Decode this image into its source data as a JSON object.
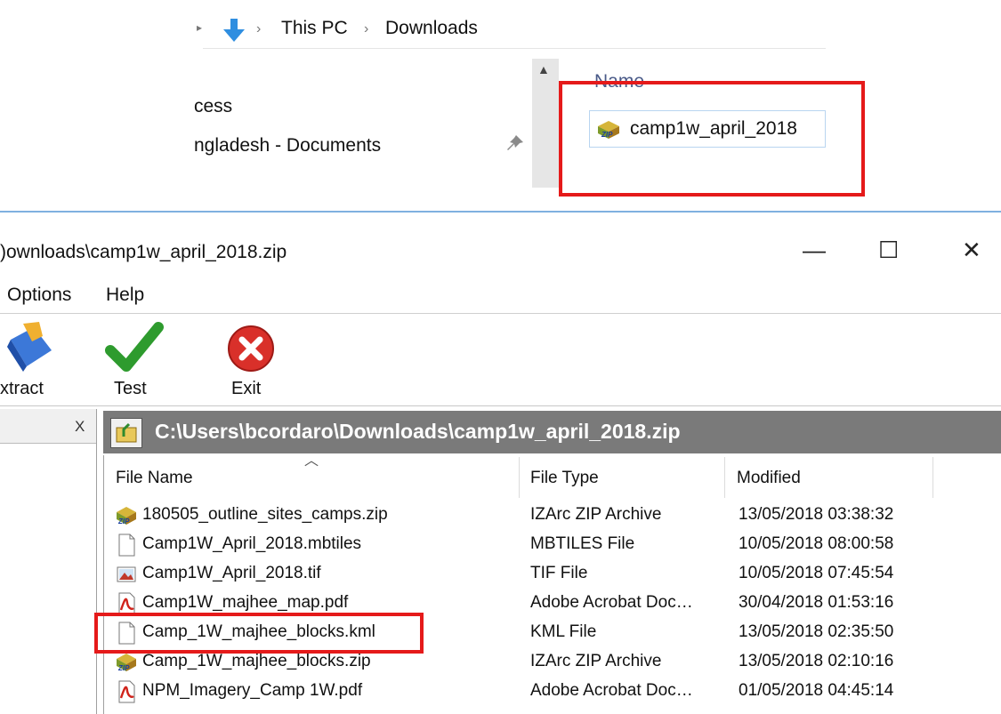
{
  "explorer": {
    "breadcrumb": [
      "This PC",
      "Downloads"
    ],
    "nav_items": [
      "cess",
      "ngladesh - Documents"
    ],
    "column_header": "Name",
    "selected_file": "camp1w_april_2018"
  },
  "izarc": {
    "title": ")ownloads\\camp1w_april_2018.zip",
    "window_buttons": {
      "minimize": "—",
      "maximize": "☐",
      "close": "✕"
    },
    "menu": [
      "Options",
      "Help"
    ],
    "toolbar": {
      "extract": "xtract",
      "test": "Test",
      "exit": "Exit"
    },
    "left_panel_close": "X",
    "path": "C:\\Users\\bcordaro\\Downloads\\camp1w_april_2018.zip",
    "columns": [
      "File Name",
      "File Type",
      "Modified"
    ],
    "files": [
      {
        "name": "180505_outline_sites_camps.zip",
        "type": "IZArc ZIP Archive",
        "modified": "13/05/2018 03:38:32",
        "icon": "zip-icon"
      },
      {
        "name": "Camp1W_April_2018.mbtiles",
        "type": "MBTILES File",
        "modified": "10/05/2018 08:00:58",
        "icon": "blank-file-icon"
      },
      {
        "name": "Camp1W_April_2018.tif",
        "type": "TIF File",
        "modified": "10/05/2018 07:45:54",
        "icon": "image-file-icon"
      },
      {
        "name": "Camp1W_majhee_map.pdf",
        "type": "Adobe Acrobat Doc…",
        "modified": "30/04/2018 01:53:16",
        "icon": "pdf-icon"
      },
      {
        "name": "Camp_1W_majhee_blocks.kml",
        "type": "KML File",
        "modified": "13/05/2018 02:35:50",
        "icon": "blank-file-icon"
      },
      {
        "name": "Camp_1W_majhee_blocks.zip",
        "type": "IZArc ZIP Archive",
        "modified": "13/05/2018 02:10:16",
        "icon": "zip-icon"
      },
      {
        "name": "NPM_Imagery_Camp 1W.pdf",
        "type": "Adobe Acrobat Doc…",
        "modified": "01/05/2018 04:45:14",
        "icon": "pdf-icon"
      }
    ]
  },
  "colors": {
    "highlight_red": "#e51a1a",
    "path_bar": "#7a7a7a"
  }
}
